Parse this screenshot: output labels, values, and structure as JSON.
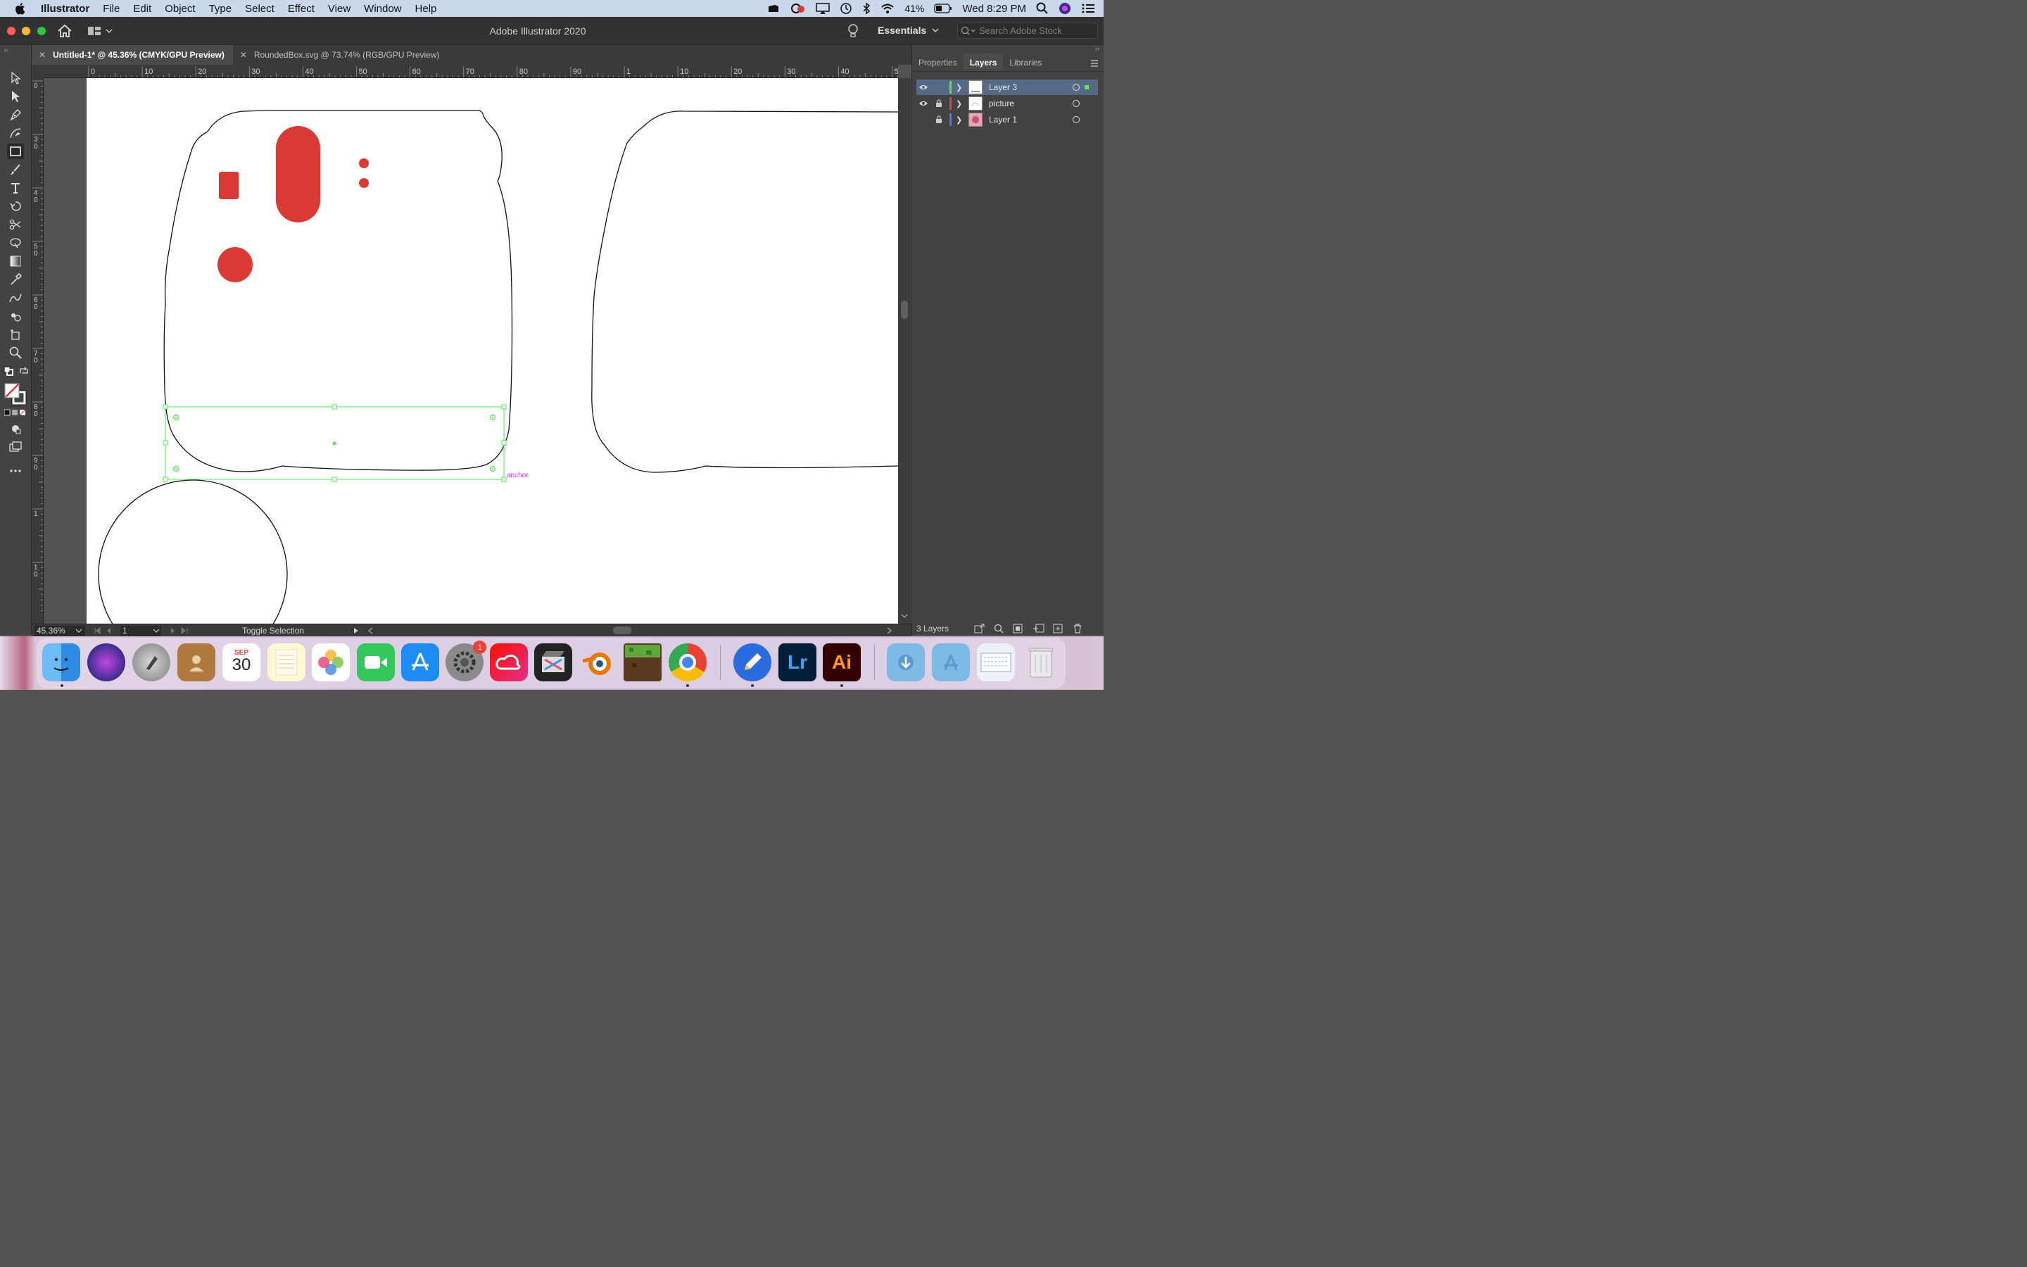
{
  "menubar": {
    "app_name": "Illustrator",
    "items": [
      "File",
      "Edit",
      "Object",
      "Type",
      "Select",
      "Effect",
      "View",
      "Window",
      "Help"
    ],
    "battery": "41%",
    "clock": "Wed 8:29 PM"
  },
  "titlebar": {
    "title": "Adobe Illustrator 2020",
    "workspace": "Essentials",
    "search_placeholder": "Search Adobe Stock"
  },
  "doc_tabs": [
    {
      "label": "Untitled-1* @ 45.36% (CMYK/GPU Preview)",
      "active": true
    },
    {
      "label": "RoundedBox.svg @ 73.74% (RGB/GPU Preview)",
      "active": false
    }
  ],
  "ruler_top_labels": [
    "0",
    "10",
    "20",
    "30",
    "40",
    "50",
    "60",
    "70",
    "80",
    "90",
    "1",
    "10",
    "20",
    "30",
    "40",
    "50"
  ],
  "ruler_left_labels": [
    "0",
    "3\n0",
    "4\n0",
    "5\n0",
    "6\n0",
    "7\n0",
    "8\n0",
    "9\n0",
    "1",
    "1\n0"
  ],
  "canvas": {
    "anchor_hint": "anchor",
    "accent_color": "#d93a33",
    "selection_color": "#4ee84e"
  },
  "status": {
    "zoom": "45.36%",
    "artboard_number": "1",
    "status_text": "Toggle Selection"
  },
  "right_panel": {
    "tabs": [
      {
        "label": "Properties",
        "active": false
      },
      {
        "label": "Layers",
        "active": true
      },
      {
        "label": "Libraries",
        "active": false
      }
    ],
    "layers": [
      {
        "name": "Layer 3",
        "visible": true,
        "locked": false,
        "color": "#4ee84e",
        "selected": true
      },
      {
        "name": "picture",
        "visible": true,
        "locked": true,
        "color": "#e0453c",
        "selected": false
      },
      {
        "name": "Layer 1",
        "visible": false,
        "locked": true,
        "color": "#5470e8",
        "selected": false
      }
    ],
    "footer": "3 Layers"
  },
  "dock": {
    "calendar_month": "SEP",
    "calendar_day": "30",
    "settings_badge": "1",
    "lightroom_label": "Lr",
    "illustrator_label": "Ai"
  }
}
